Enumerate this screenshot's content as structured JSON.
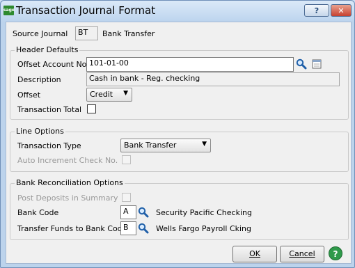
{
  "window": {
    "title": "Transaction Journal Format",
    "logo_text": "sage",
    "help_glyph": "?",
    "close_glyph": "✕"
  },
  "source": {
    "label": "Source Journal",
    "code": "BT",
    "name": "Bank Transfer"
  },
  "header_defaults": {
    "group_label": "Header Defaults",
    "offset_account_label": "Offset Account No.",
    "offset_account_value": "101-01-00",
    "description_label": "Description",
    "description_value": "Cash in bank - Reg. checking",
    "offset_label": "Offset",
    "offset_value": "Credit",
    "transaction_total_label": "Transaction Total"
  },
  "line_options": {
    "group_label": "Line Options",
    "transaction_type_label": "Transaction Type",
    "transaction_type_value": "Bank Transfer",
    "auto_increment_label": "Auto Increment Check No."
  },
  "bank_rec": {
    "group_label": "Bank Reconciliation Options",
    "post_deposits_label": "Post Deposits in Summary",
    "bank_code_label": "Bank Code",
    "bank_code_value": "A",
    "bank_code_name": "Security Pacific Checking",
    "transfer_label": "Transfer Funds to Bank Code",
    "transfer_value": "B",
    "transfer_name": "Wells Fargo Payroll Cking"
  },
  "footer": {
    "ok_label": "OK",
    "cancel_label": "Cancel",
    "help_glyph": "?"
  },
  "icons": {
    "lookup": "magnifier-icon",
    "calendar": "calendar-icon",
    "dropdown": "chevron-down-icon"
  },
  "colors": {
    "accent": "#1f5fa8",
    "close": "#c74130",
    "help": "#2f9a4a"
  }
}
